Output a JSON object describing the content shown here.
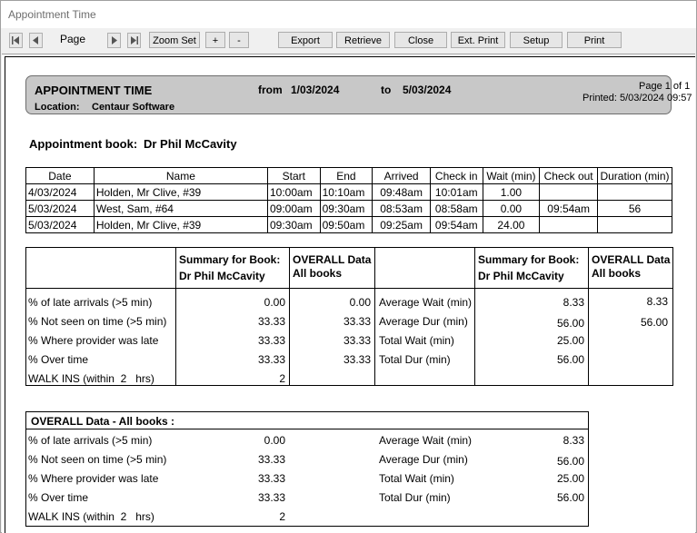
{
  "window": {
    "title": "Appointment Time"
  },
  "toolbar": {
    "page_label": "Page",
    "zoom_set": "Zoom Set",
    "zoom_in": "+",
    "zoom_out": "-",
    "export": "Export",
    "retrieve": "Retrieve",
    "close": "Close",
    "ext_print": "Ext. Print",
    "setup": "Setup",
    "print": "Print"
  },
  "report": {
    "title": "APPOINTMENT TIME",
    "from_label": "from",
    "from_date": "1/03/2024",
    "to_label": "to",
    "to_date": "5/03/2024",
    "location_label": "Location:",
    "location": "Centaur Software",
    "page_info": "Page 1 of 1",
    "printed": "Printed: 5/03/2024 09:57",
    "book_label": "Appointment book:",
    "book_name": "Dr Phil McCavity"
  },
  "appointments": {
    "headers": [
      "Date",
      "Name",
      "Start",
      "End",
      "Arrived",
      "Check in",
      "Wait (min)",
      "Check out",
      "Duration (min)"
    ],
    "rows": [
      [
        "4/03/2024",
        "Holden, Mr Clive, #39",
        "10:00am",
        "10:10am",
        "09:48am",
        "10:01am",
        "1.00",
        "",
        ""
      ],
      [
        "5/03/2024",
        "West, Sam, #64",
        "09:00am",
        "09:30am",
        "08:53am",
        "08:58am",
        "0.00",
        "09:54am",
        "56"
      ],
      [
        "5/03/2024",
        "Holden, Mr Clive, #39",
        "09:30am",
        "09:50am",
        "09:25am",
        "09:54am",
        "24.00",
        "",
        ""
      ]
    ]
  },
  "summary": {
    "book_header_1": "Summary for Book:",
    "book_header_2": "Dr Phil McCavity",
    "overall_header_1": "OVERALL Data",
    "overall_header_2": "All books",
    "left_rows": [
      {
        "label": "% of late arrivals (>5 min)",
        "book": "0.00",
        "overall": "0.00"
      },
      {
        "label": "% Not seen on time (>5 min)",
        "book": "33.33",
        "overall": "33.33"
      },
      {
        "label": "% Where provider was late",
        "book": "33.33",
        "overall": "33.33"
      },
      {
        "label": "% Over time",
        "book": "33.33",
        "overall": "33.33"
      },
      {
        "label": "WALK INS (within  2   hrs)",
        "book": "2",
        "overall": ""
      }
    ],
    "right_rows": [
      {
        "label": "Average Wait (min)",
        "book": "8.33",
        "overall": "8.33"
      },
      {
        "label": "Average Dur (min)",
        "book": "56.00",
        "overall": "56.00"
      },
      {
        "label": "Total Wait (min)",
        "book": "25.00",
        "overall": ""
      },
      {
        "label": "Total Dur (min)",
        "book": "56.00",
        "overall": ""
      }
    ]
  },
  "overall": {
    "title": "OVERALL Data - All books :",
    "left_rows": [
      {
        "label": "% of late arrivals (>5 min)",
        "value": "0.00"
      },
      {
        "label": "% Not seen on time (>5 min)",
        "value": "33.33"
      },
      {
        "label": "% Where provider was late",
        "value": "33.33"
      },
      {
        "label": "% Over time",
        "value": "33.33"
      },
      {
        "label": "WALK INS (within  2   hrs)",
        "value": "2"
      }
    ],
    "right_rows": [
      {
        "label": "Average Wait (min)",
        "value": "8.33"
      },
      {
        "label": "Average Dur (min)",
        "value": "56.00"
      },
      {
        "label": "Total Wait (min)",
        "value": "25.00"
      },
      {
        "label": "Total Dur (min)",
        "value": "56.00"
      }
    ]
  }
}
